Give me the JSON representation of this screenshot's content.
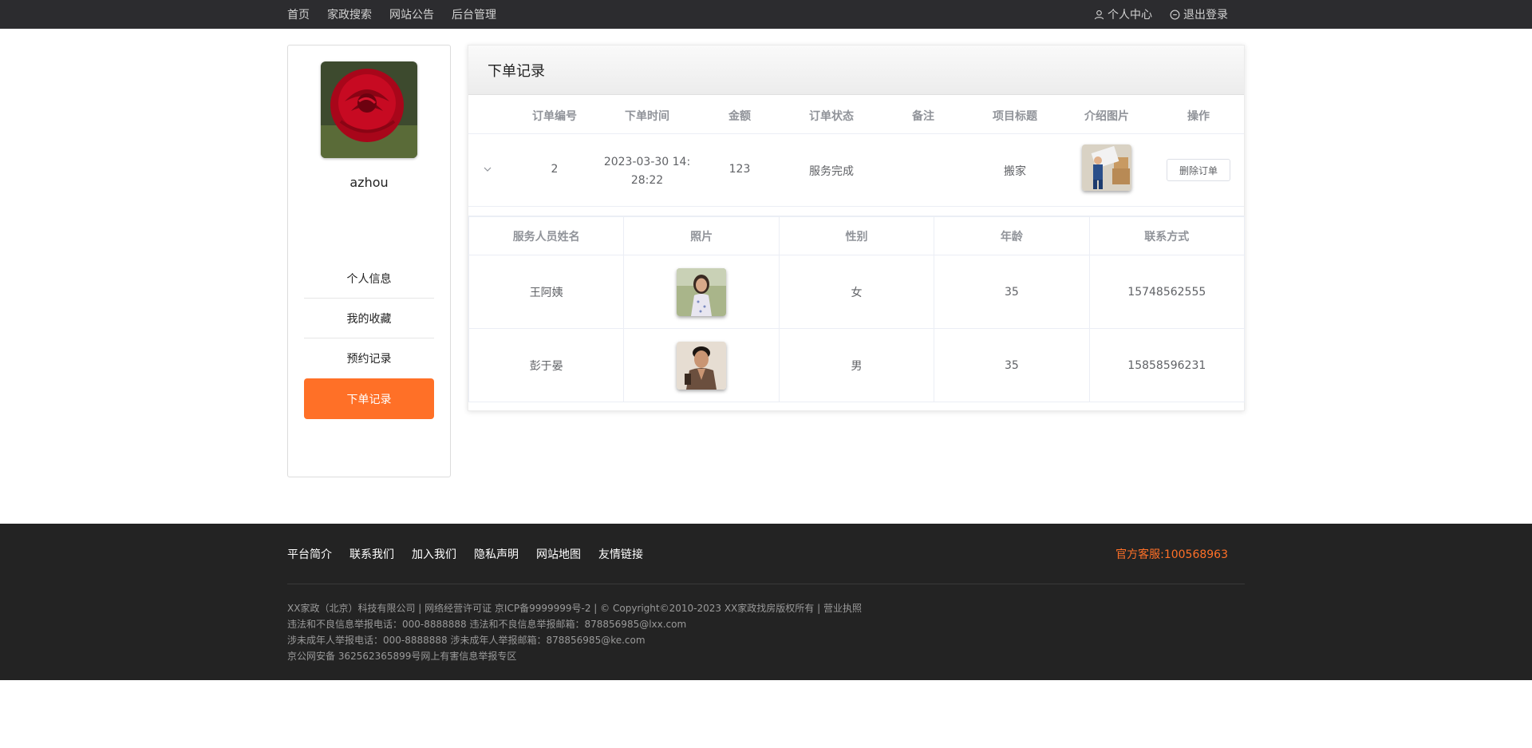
{
  "topnav": {
    "items": [
      "首页",
      "家政搜索",
      "网站公告",
      "后台管理"
    ],
    "user_center": "个人中心",
    "logout": "退出登录"
  },
  "sidebar": {
    "username": "azhou",
    "menu": [
      "个人信息",
      "我的收藏",
      "预约记录",
      "下单记录"
    ],
    "active_index": 3
  },
  "panel": {
    "title": "下单记录",
    "columns": [
      "订单编号",
      "下单时间",
      "金额",
      "订单状态",
      "备注",
      "项目标题",
      "介绍图片",
      "操作"
    ],
    "order": {
      "id": "2",
      "time_line1": "2023-03-30 14:",
      "time_line2": "28:22",
      "amount": "123",
      "status": "服务完成",
      "remark": "",
      "project_title": "搬家",
      "action": "删除订单"
    },
    "staff_columns": [
      "服务人员姓名",
      "照片",
      "性别",
      "年龄",
      "联系方式"
    ],
    "staff": [
      {
        "name": "王阿姨",
        "gender": "女",
        "age": "35",
        "phone": "15748562555"
      },
      {
        "name": "彭于晏",
        "gender": "男",
        "age": "35",
        "phone": "15858596231"
      }
    ]
  },
  "footer": {
    "links": [
      "平台简介",
      "联系我们",
      "加入我们",
      "隐私声明",
      "网站地图",
      "友情链接"
    ],
    "service": "官方客服:100568963",
    "lines": [
      "XX家政（北京）科技有限公司 | 网络经营许可证 京ICP备9999999号-2 | © Copyright©2010-2023 XX家政找房版权所有 | 营业执照",
      "违法和不良信息举报电话：000-8888888 违法和不良信息举报邮箱：878856985@lxx.com",
      "涉未成年人举报电话：000-8888888 涉未成年人举报邮箱：878856985@ke.com",
      "京公网安备 362562365899号网上有害信息举报专区"
    ]
  },
  "colors": {
    "accent": "#ff7027",
    "topbar_bg": "#2c2c2f",
    "footer_bg": "#232323"
  }
}
